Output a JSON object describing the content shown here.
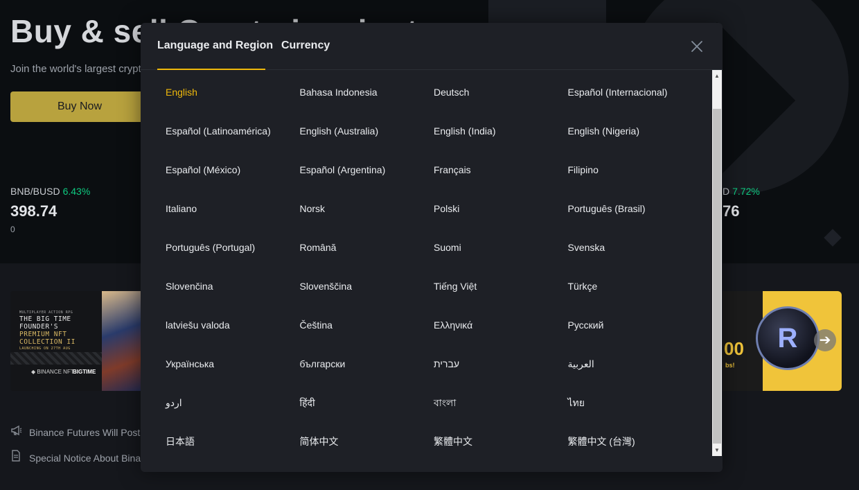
{
  "hero": {
    "title": "Buy & sell Crypto in minutes",
    "subtitle": "Join the world's largest crypto exchange",
    "buy_button": "Buy Now"
  },
  "tickers": {
    "left": {
      "pair": "BNB/BUSD",
      "change": "6.43%",
      "price": "398.74",
      "volume": "0"
    },
    "right": {
      "pair": "D",
      "change": "7.72%",
      "price": "76"
    }
  },
  "banner_left": {
    "tag": "MULTIPLAYER ACTION RPG",
    "line1": "THE BIG TIME",
    "line2": "FOUNDER'S",
    "line3": "PREMIUM NFT",
    "line4": "COLLECTION II",
    "line5": "LAUNCHING ON 27TH AUG",
    "brand1": "◆ BINANCE NFT",
    "brand2": "BIGTIME"
  },
  "banner_right": {
    "number": "00",
    "tagline": "bs!",
    "coin_letter": "R"
  },
  "notices": [
    {
      "icon": "megaphone-icon",
      "text": "Binance Futures Will Post"
    },
    {
      "icon": "document-icon",
      "text": "Special Notice About Bina"
    }
  ],
  "modal": {
    "tabs": [
      {
        "label": "Language and Region",
        "active": true
      },
      {
        "label": "Currency",
        "active": false
      }
    ],
    "close_icon": "close-icon",
    "accent_color": "#f0b90b",
    "selected_language": "English",
    "languages": [
      "English",
      "Bahasa Indonesia",
      "Deutsch",
      "Español (Internacional)",
      "Español (Latinoamérica)",
      "English (Australia)",
      "English (India)",
      "English (Nigeria)",
      "Español (México)",
      "Español (Argentina)",
      "Français",
      "Filipino",
      "Italiano",
      "Norsk",
      "Polski",
      "Português (Brasil)",
      "Português (Portugal)",
      "Română",
      "Suomi",
      "Svenska",
      "Slovenčina",
      "Slovenščina",
      "Tiếng Việt",
      "Türkçe",
      "latviešu valoda",
      "Čeština",
      "Ελληνικά",
      "Русский",
      "Українська",
      "български",
      "עברית",
      "العربية",
      "اردو",
      "हिंदी",
      "বাংলা",
      "ไทย",
      "日本語",
      "简体中文",
      "繁體中文",
      "繁體中文 (台灣)"
    ]
  }
}
